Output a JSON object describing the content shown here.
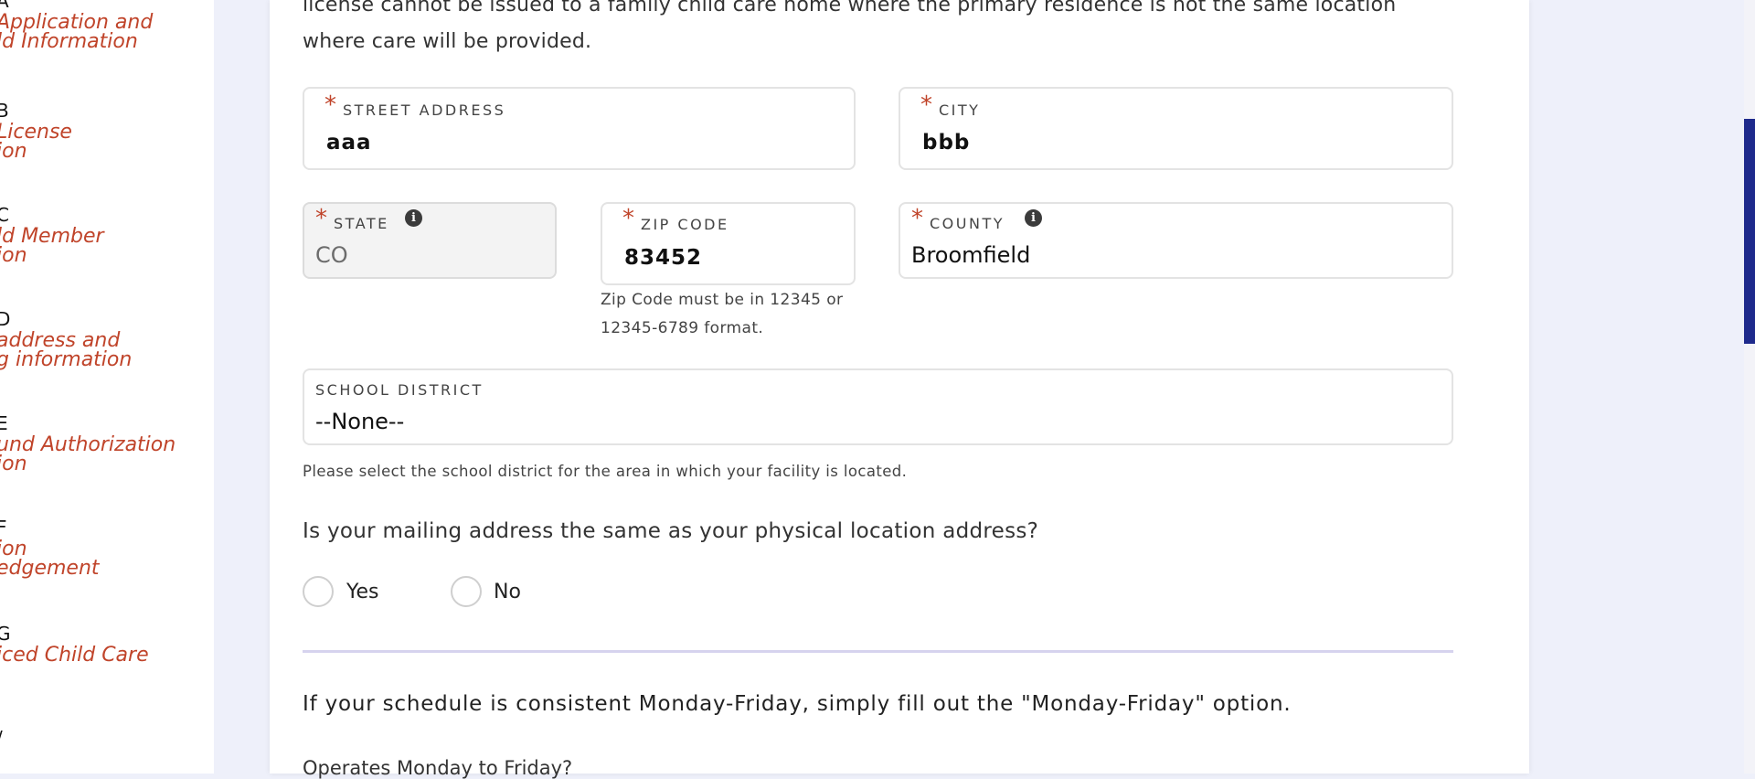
{
  "sidebar": {
    "steps": [
      {
        "letter": "A",
        "title": "Application and\nld Information"
      },
      {
        "letter": "B",
        "title": "License\nion"
      },
      {
        "letter": "C",
        "title": "ld Member\nion"
      },
      {
        "letter": "D",
        "title": "address and\ng information"
      },
      {
        "letter": "E",
        "title": "und Authorization\nion"
      },
      {
        "letter": "F",
        "title": "ion\nedgement"
      },
      {
        "letter": "G",
        "title": "iced Child Care"
      },
      {
        "letter": "/",
        "title": ""
      }
    ]
  },
  "main": {
    "intro_line1": "license cannot be issued to a family child care home where the primary residence is not the same location",
    "intro_line2": "where care will be provided.",
    "required_marker": "*",
    "street": {
      "label": "STREET ADDRESS",
      "value": "aaa"
    },
    "city": {
      "label": "CITY",
      "value": "bbb"
    },
    "state": {
      "label": "STATE",
      "value": "CO"
    },
    "zip": {
      "label": "ZIP CODE",
      "value": "83452",
      "help_line1": "Zip Code must be in 12345 or",
      "help_line2": "12345-6789 format."
    },
    "county": {
      "label": "COUNTY",
      "value": "Broomfield"
    },
    "school_district": {
      "label": "SCHOOL DISTRICT",
      "value": "--None--",
      "help": "Please select the school district for the area in which your facility is located."
    },
    "mailing_question": "Is your mailing address the same as your physical location address?",
    "options": {
      "yes": "Yes",
      "no": "No"
    },
    "schedule_note": "If your schedule is consistent Monday-Friday, simply fill out the \"Monday-Friday\" option.",
    "operates_question": "Operates Monday to Friday?"
  },
  "icons": {
    "info": "info-icon"
  },
  "colors": {
    "accent": "#c0442a",
    "scrollbar": "#1e2a8c",
    "background": "#eef0fa"
  }
}
